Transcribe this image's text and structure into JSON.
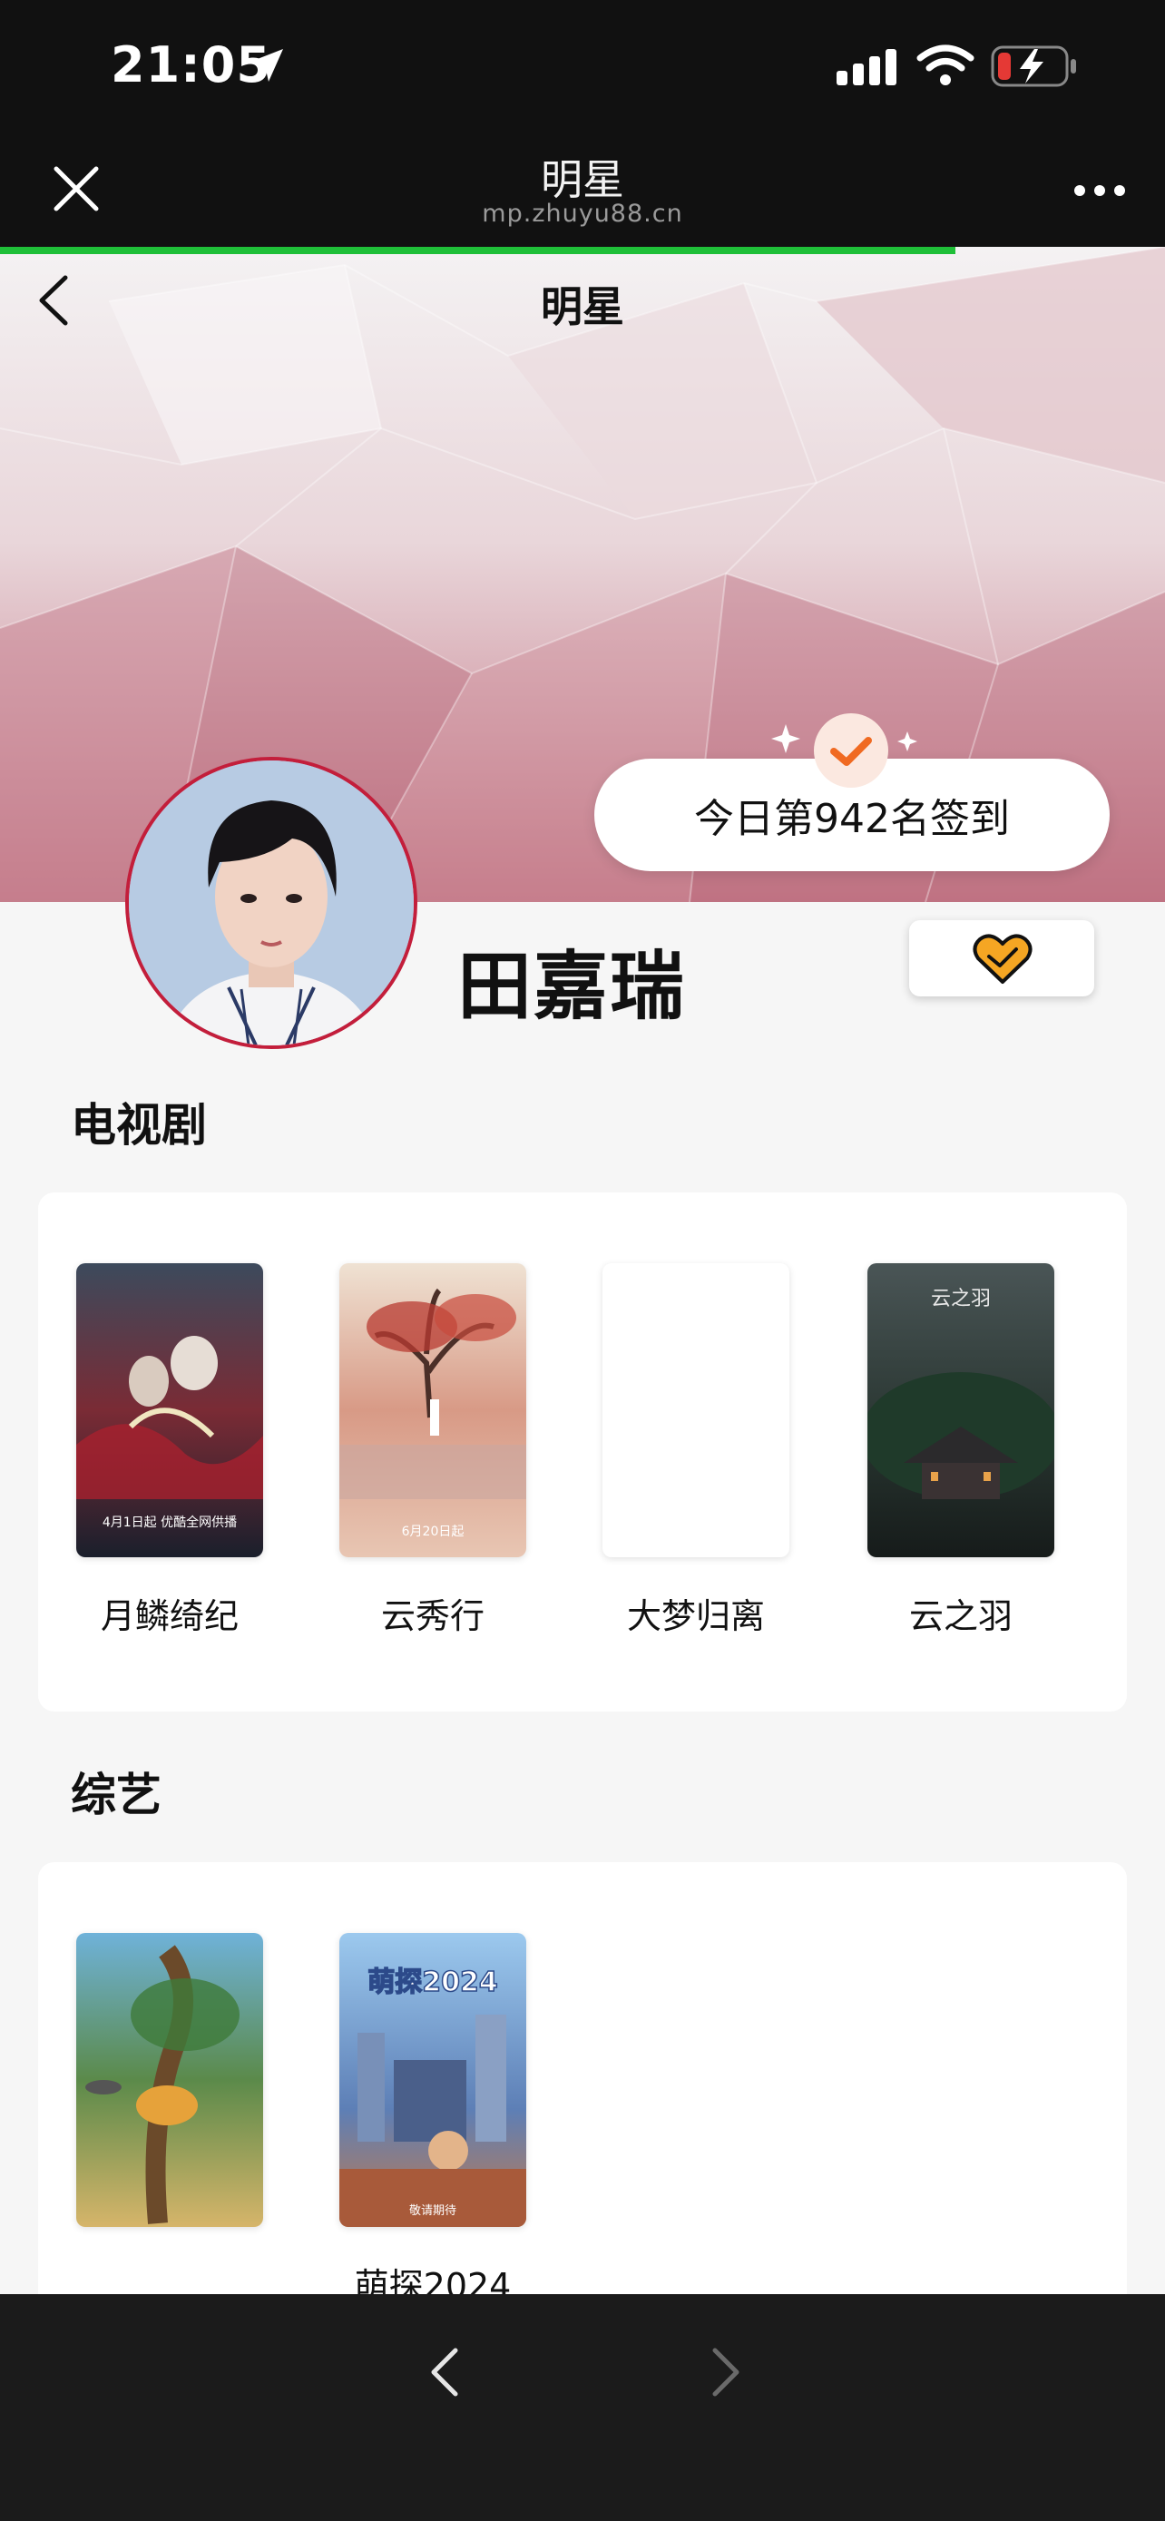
{
  "status_bar": {
    "time": "21:05"
  },
  "browser": {
    "title": "明星",
    "domain": "mp.zhuyu88.cn",
    "load_progress": 0.82
  },
  "page": {
    "title": "明星"
  },
  "checkin": {
    "text": "今日第942名签到"
  },
  "star": {
    "name": "田嘉瑞"
  },
  "sections": {
    "tv": {
      "title": "电视剧",
      "items": [
        {
          "label": "月鳞绮纪",
          "poster_caption": "4月1日起 优酷全网供播"
        },
        {
          "label": "云秀行",
          "poster_caption": "6月20日起"
        },
        {
          "label": "大梦归离"
        },
        {
          "label": "云之羽",
          "poster_caption": "云之羽"
        }
      ]
    },
    "variety": {
      "title": "综艺",
      "items": [
        {
          "label": ""
        },
        {
          "label": "萌探2024",
          "poster_caption": "萌探2024",
          "poster_sub": "敬请期待"
        }
      ]
    }
  },
  "colors": {
    "progress": "#1fbf38",
    "accent": "#f2a51c",
    "avatar_ring": "#c31e3b"
  }
}
